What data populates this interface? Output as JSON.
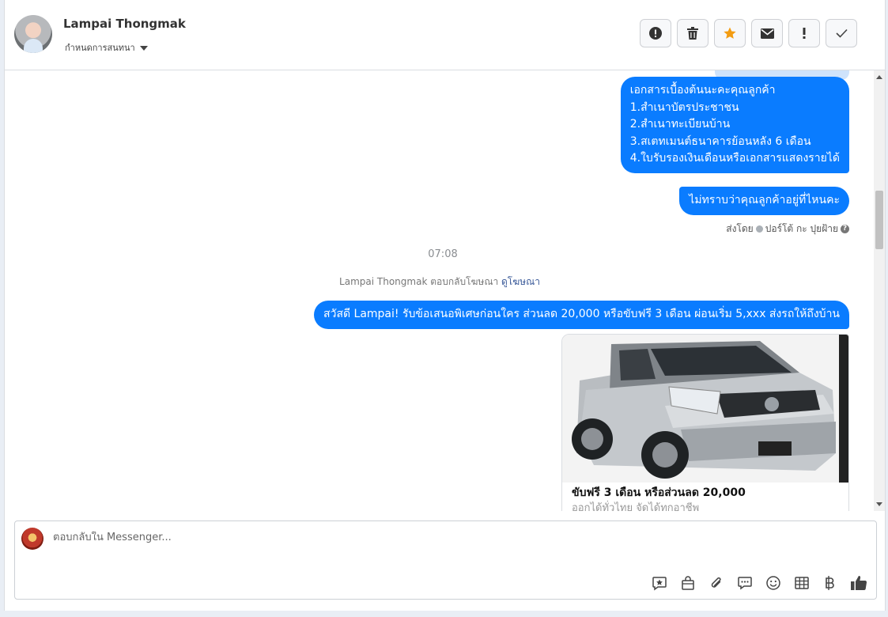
{
  "header": {
    "contact_name": "Lampai Thongmak",
    "assign_label": "กำหนดการสนทนา"
  },
  "actions": [
    {
      "name": "report-spam-button",
      "icon": "alert-circle-icon"
    },
    {
      "name": "delete-button",
      "icon": "trash-icon"
    },
    {
      "name": "star-button",
      "icon": "star-icon",
      "color": "#f39c12"
    },
    {
      "name": "mark-unread-button",
      "icon": "envelope-icon"
    },
    {
      "name": "follow-up-button",
      "icon": "exclamation-icon"
    },
    {
      "name": "mark-done-button",
      "icon": "checkmark-icon"
    }
  ],
  "messages": {
    "docs": "เอกสารเบื้องต้นนะคะคุณลูกค้า\n1.สำเนาบัตรประชาชน\n2.สำเนาทะเบียนบ้าน\n3.สเตทเมนต์ธนาคารย้อนหลัง 6 เดือน\n4.ใบรับรองเงินเดือนหรือเอกสารแสดงรายได้",
    "location_q": "ไม่ทราบว่าคุณลูกค้าอยู่ที่ไหนคะ",
    "sent_by_prefix": "ส่งโดย",
    "sent_by_name": "ปอร์โต้ กะ ปุยฝ้าย",
    "time": "07:08",
    "reply_ad_text": "Lampai Thongmak ตอบกลับโฆษณา",
    "reply_ad_link": "ดูโฆษณา",
    "offer": "สวัสดี Lampai! รับข้อเสนอพิเศษก่อนใคร ส่วนลด 20,000 หรือขับฟรี 3 เดือน ผ่อนเริ่ม 5,xxx ส่งรถให้ถึงบ้าน"
  },
  "ad_card": {
    "title": "ขับฟรี 3 เดือน หรือส่วนลด 20,000",
    "subtitle": "ออกได้ทั่วไทย จัดได้ทุกอาชีพ",
    "image_desc": "silver-pickup-truck-image"
  },
  "composer": {
    "placeholder": "ตอบกลับใน Messenger...",
    "tools": [
      "saved-reply-icon",
      "shopping-bag-icon",
      "attachment-icon",
      "chat-bubble-icon",
      "emoji-icon",
      "table-icon",
      "baht-icon",
      "thumbs-up-icon"
    ]
  },
  "colors": {
    "bubble": "#0a7cff",
    "accent_star": "#f39c12"
  }
}
